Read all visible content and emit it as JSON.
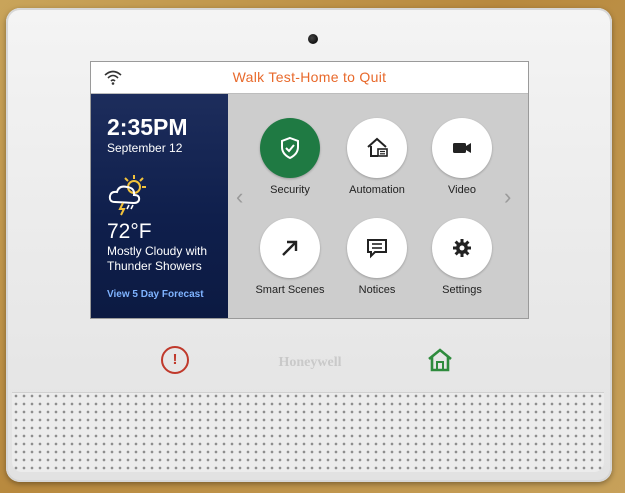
{
  "status_bar": {
    "message": "Walk Test-Home to Quit",
    "wifi_icon": "wifi-icon"
  },
  "left_panel": {
    "time": "2:35PM",
    "date": "September 12",
    "weather_icon": "storm-cloud-sun-icon",
    "temperature": "72°F",
    "condition": "Mostly Cloudy with Thunder Showers",
    "forecast_link": "View 5 Day Forecast"
  },
  "tiles": [
    {
      "label": "Security",
      "icon": "shield-check-icon",
      "active": true,
      "accent": "#1f7a43"
    },
    {
      "label": "Automation",
      "icon": "home-automation-icon"
    },
    {
      "label": "Video",
      "icon": "video-camera-icon"
    },
    {
      "label": "Smart Scenes",
      "icon": "arrow-up-right-icon"
    },
    {
      "label": "Notices",
      "icon": "message-icon"
    },
    {
      "label": "Settings",
      "icon": "gear-icon"
    }
  ],
  "hardware": {
    "brand": "Honeywell",
    "emergency_icon": "alert-icon",
    "home_icon": "home-icon",
    "alert_color": "#c0392b",
    "home_color": "#2e8b3d"
  }
}
